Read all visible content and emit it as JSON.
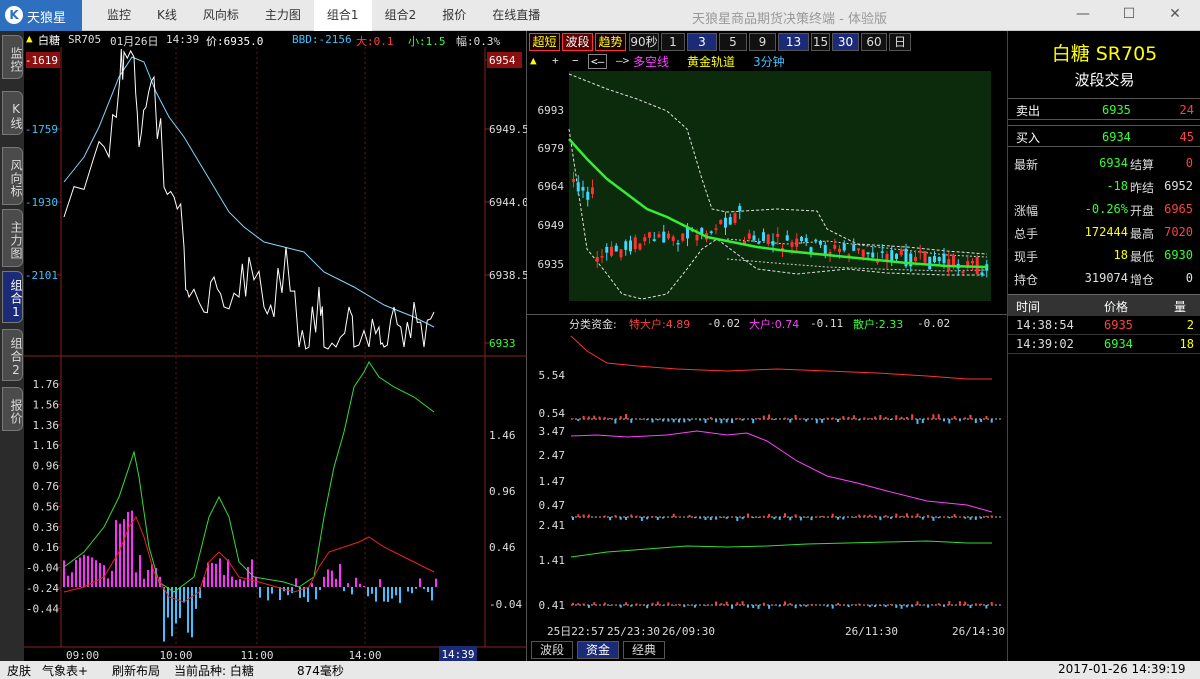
{
  "app": {
    "logo": "天狼星",
    "title": "天狼星商品期货决策终端 - 体验版",
    "menu": [
      "监控",
      "K线",
      "风向标",
      "主力图",
      "组合1",
      "组合2",
      "报价",
      "在线直播"
    ],
    "active_menu": "组合1",
    "window_buttons": [
      "—",
      "☐",
      "✕"
    ]
  },
  "left_tabs": [
    "监控",
    "K线",
    "风向标",
    "主力图",
    "组合1",
    "组合2",
    "报价"
  ],
  "timeshare": {
    "name": "白糖",
    "code": "SR705",
    "date": "01月26日",
    "time": "14:39",
    "price_label": "价:6935.0",
    "bbd": "BBD:-2156",
    "big": "大:0.1",
    "small": "小:1.5",
    "amp": "幅:0.3%",
    "left_axis": [
      "-1619",
      "-1759",
      "-1930",
      "-2101"
    ],
    "right_axis": [
      "6954",
      "6949.5",
      "6944.0",
      "6938.5",
      "6933"
    ],
    "lower_left_axis": [
      "1.76",
      "1.56",
      "1.36",
      "1.16",
      "0.96",
      "0.76",
      "0.56",
      "0.36",
      "0.16",
      "-0.04",
      "-0.24",
      "-0.44"
    ],
    "lower_right_axis": [
      "1.46",
      "0.96",
      "0.46",
      "-0.04"
    ],
    "x_axis": [
      "09:00",
      "10:00",
      "11:00",
      "14:00"
    ],
    "cursor_time": "14:39"
  },
  "kline": {
    "buttons": [
      "超短",
      "波段",
      "趋势",
      "90秒",
      "1",
      "3",
      "5",
      "9",
      "13",
      "15",
      "30",
      "60",
      "日"
    ],
    "toolbar": [
      "▲",
      "+",
      "−",
      "<—",
      "—>"
    ],
    "indicator": "多空线",
    "channel": "黄金轨道",
    "period": "3分钟",
    "y_axis": [
      "6993",
      "6979",
      "6964",
      "6949",
      "6935"
    ]
  },
  "funds": {
    "title": "分类资金:",
    "special_big": "特大户:4.89",
    "special_big_chg": "-0.02",
    "big": "大户:0.74",
    "big_chg": "-0.11",
    "retail": "散户:2.33",
    "retail_chg": "-0.02",
    "axis1": [
      "5.54",
      "0.54"
    ],
    "axis2": [
      "3.47",
      "2.47",
      "1.47",
      "0.47"
    ],
    "axis3": [
      "2.41",
      "1.41",
      "0.41"
    ],
    "x_axis": [
      "25日22:57",
      "25/23:30",
      "26/09:30",
      "26/11:30",
      "26/14:30"
    ],
    "tabs": [
      "波段",
      "资金",
      "经典"
    ],
    "active_tab": "资金"
  },
  "quote": {
    "name": "白糖 SR705",
    "mode": "波段交易",
    "sell": {
      "label": "卖出",
      "price": "6935",
      "vol": "24"
    },
    "buy": {
      "label": "买入",
      "price": "6934",
      "vol": "45"
    },
    "stats": [
      {
        "l1": "最新",
        "v1": "6934",
        "c1": "#33ff33",
        "l2": "结算",
        "v2": "0",
        "c2": "#ff4040"
      },
      {
        "l1": "",
        "v1": "-18",
        "c1": "#33ff33",
        "l2": "昨结",
        "v2": "6952",
        "c2": "#e0e0e0"
      },
      {
        "l1": "涨幅",
        "v1": "-0.26%",
        "c1": "#33ff33",
        "l2": "开盘",
        "v2": "6965",
        "c2": "#ff4040"
      },
      {
        "l1": "总手",
        "v1": "172444",
        "c1": "#ffff00",
        "l2": "最高",
        "v2": "7020",
        "c2": "#ff4040"
      },
      {
        "l1": "现手",
        "v1": "18",
        "c1": "#ffff00",
        "l2": "最低",
        "v2": "6930",
        "c2": "#33ff33"
      },
      {
        "l1": "持仓",
        "v1": "319074",
        "c1": "#e0e0e0",
        "l2": "增仓",
        "v2": "0",
        "c2": "#e0e0e0"
      }
    ],
    "ticks_header": [
      "时间",
      "价格",
      "量"
    ],
    "ticks": [
      {
        "time": "14:38:54",
        "price": "6935",
        "vol": "2",
        "pc": "#ff4040",
        "vc": "#ffff00"
      },
      {
        "time": "14:39:02",
        "price": "6934",
        "vol": "18",
        "pc": "#33ff33",
        "vc": "#ffff00"
      }
    ]
  },
  "status": {
    "skin": "皮肤",
    "weather": "气象表+",
    "refresh": "刷新布局",
    "current": "当前品种: 白糖",
    "latency": "874毫秒",
    "datetime": "2017-01-26 14:39:19"
  }
}
